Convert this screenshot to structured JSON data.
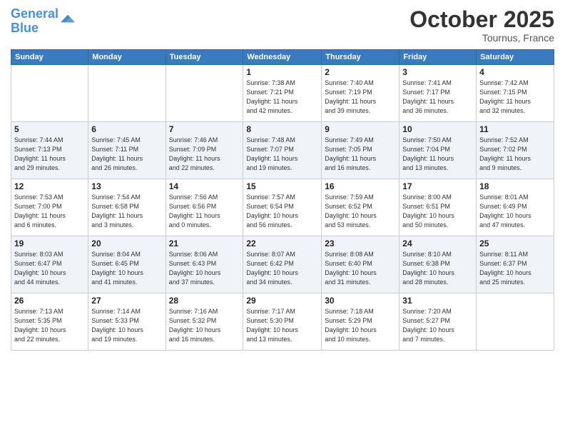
{
  "logo": {
    "line1": "General",
    "line2": "Blue"
  },
  "title": "October 2025",
  "location": "Tournus, France",
  "days_header": [
    "Sunday",
    "Monday",
    "Tuesday",
    "Wednesday",
    "Thursday",
    "Friday",
    "Saturday"
  ],
  "weeks": [
    [
      {
        "day": "",
        "info": ""
      },
      {
        "day": "",
        "info": ""
      },
      {
        "day": "",
        "info": ""
      },
      {
        "day": "1",
        "info": "Sunrise: 7:38 AM\nSunset: 7:21 PM\nDaylight: 11 hours\nand 42 minutes."
      },
      {
        "day": "2",
        "info": "Sunrise: 7:40 AM\nSunset: 7:19 PM\nDaylight: 11 hours\nand 39 minutes."
      },
      {
        "day": "3",
        "info": "Sunrise: 7:41 AM\nSunset: 7:17 PM\nDaylight: 11 hours\nand 36 minutes."
      },
      {
        "day": "4",
        "info": "Sunrise: 7:42 AM\nSunset: 7:15 PM\nDaylight: 11 hours\nand 32 minutes."
      }
    ],
    [
      {
        "day": "5",
        "info": "Sunrise: 7:44 AM\nSunset: 7:13 PM\nDaylight: 11 hours\nand 29 minutes."
      },
      {
        "day": "6",
        "info": "Sunrise: 7:45 AM\nSunset: 7:11 PM\nDaylight: 11 hours\nand 26 minutes."
      },
      {
        "day": "7",
        "info": "Sunrise: 7:46 AM\nSunset: 7:09 PM\nDaylight: 11 hours\nand 22 minutes."
      },
      {
        "day": "8",
        "info": "Sunrise: 7:48 AM\nSunset: 7:07 PM\nDaylight: 11 hours\nand 19 minutes."
      },
      {
        "day": "9",
        "info": "Sunrise: 7:49 AM\nSunset: 7:05 PM\nDaylight: 11 hours\nand 16 minutes."
      },
      {
        "day": "10",
        "info": "Sunrise: 7:50 AM\nSunset: 7:04 PM\nDaylight: 11 hours\nand 13 minutes."
      },
      {
        "day": "11",
        "info": "Sunrise: 7:52 AM\nSunset: 7:02 PM\nDaylight: 11 hours\nand 9 minutes."
      }
    ],
    [
      {
        "day": "12",
        "info": "Sunrise: 7:53 AM\nSunset: 7:00 PM\nDaylight: 11 hours\nand 6 minutes."
      },
      {
        "day": "13",
        "info": "Sunrise: 7:54 AM\nSunset: 6:58 PM\nDaylight: 11 hours\nand 3 minutes."
      },
      {
        "day": "14",
        "info": "Sunrise: 7:56 AM\nSunset: 6:56 PM\nDaylight: 11 hours\nand 0 minutes."
      },
      {
        "day": "15",
        "info": "Sunrise: 7:57 AM\nSunset: 6:54 PM\nDaylight: 10 hours\nand 56 minutes."
      },
      {
        "day": "16",
        "info": "Sunrise: 7:59 AM\nSunset: 6:52 PM\nDaylight: 10 hours\nand 53 minutes."
      },
      {
        "day": "17",
        "info": "Sunrise: 8:00 AM\nSunset: 6:51 PM\nDaylight: 10 hours\nand 50 minutes."
      },
      {
        "day": "18",
        "info": "Sunrise: 8:01 AM\nSunset: 6:49 PM\nDaylight: 10 hours\nand 47 minutes."
      }
    ],
    [
      {
        "day": "19",
        "info": "Sunrise: 8:03 AM\nSunset: 6:47 PM\nDaylight: 10 hours\nand 44 minutes."
      },
      {
        "day": "20",
        "info": "Sunrise: 8:04 AM\nSunset: 6:45 PM\nDaylight: 10 hours\nand 41 minutes."
      },
      {
        "day": "21",
        "info": "Sunrise: 8:06 AM\nSunset: 6:43 PM\nDaylight: 10 hours\nand 37 minutes."
      },
      {
        "day": "22",
        "info": "Sunrise: 8:07 AM\nSunset: 6:42 PM\nDaylight: 10 hours\nand 34 minutes."
      },
      {
        "day": "23",
        "info": "Sunrise: 8:08 AM\nSunset: 6:40 PM\nDaylight: 10 hours\nand 31 minutes."
      },
      {
        "day": "24",
        "info": "Sunrise: 8:10 AM\nSunset: 6:38 PM\nDaylight: 10 hours\nand 28 minutes."
      },
      {
        "day": "25",
        "info": "Sunrise: 8:11 AM\nSunset: 6:37 PM\nDaylight: 10 hours\nand 25 minutes."
      }
    ],
    [
      {
        "day": "26",
        "info": "Sunrise: 7:13 AM\nSunset: 5:35 PM\nDaylight: 10 hours\nand 22 minutes."
      },
      {
        "day": "27",
        "info": "Sunrise: 7:14 AM\nSunset: 5:33 PM\nDaylight: 10 hours\nand 19 minutes."
      },
      {
        "day": "28",
        "info": "Sunrise: 7:16 AM\nSunset: 5:32 PM\nDaylight: 10 hours\nand 16 minutes."
      },
      {
        "day": "29",
        "info": "Sunrise: 7:17 AM\nSunset: 5:30 PM\nDaylight: 10 hours\nand 13 minutes."
      },
      {
        "day": "30",
        "info": "Sunrise: 7:18 AM\nSunset: 5:29 PM\nDaylight: 10 hours\nand 10 minutes."
      },
      {
        "day": "31",
        "info": "Sunrise: 7:20 AM\nSunset: 5:27 PM\nDaylight: 10 hours\nand 7 minutes."
      },
      {
        "day": "",
        "info": ""
      }
    ]
  ]
}
